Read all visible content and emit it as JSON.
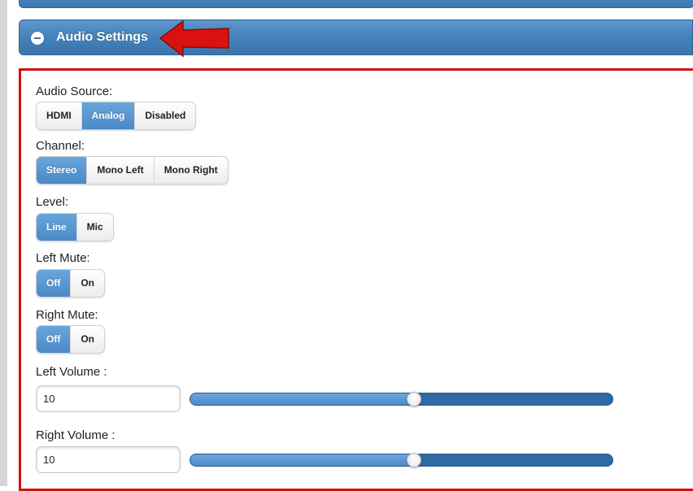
{
  "header": {
    "title": "Audio Settings",
    "icon": "minus-circle-icon"
  },
  "accent_color": "#4482bb",
  "highlight_color": "#d11111",
  "audio_source": {
    "label": "Audio Source:",
    "options": [
      "HDMI",
      "Analog",
      "Disabled"
    ],
    "selected": "Analog"
  },
  "channel": {
    "label": "Channel:",
    "options": [
      "Stereo",
      "Mono Left",
      "Mono Right"
    ],
    "selected": "Stereo"
  },
  "level": {
    "label": "Level:",
    "options": [
      "Line",
      "Mic"
    ],
    "selected": "Line"
  },
  "left_mute": {
    "label": "Left Mute:",
    "options": [
      "Off",
      "On"
    ],
    "selected": "Off"
  },
  "right_mute": {
    "label": "Right Mute:",
    "options": [
      "Off",
      "On"
    ],
    "selected": "Off"
  },
  "left_volume": {
    "label": "Left Volume :",
    "value": "10",
    "slider_fraction": 0.53
  },
  "right_volume": {
    "label": "Right Volume :",
    "value": "10",
    "slider_fraction": 0.53
  }
}
